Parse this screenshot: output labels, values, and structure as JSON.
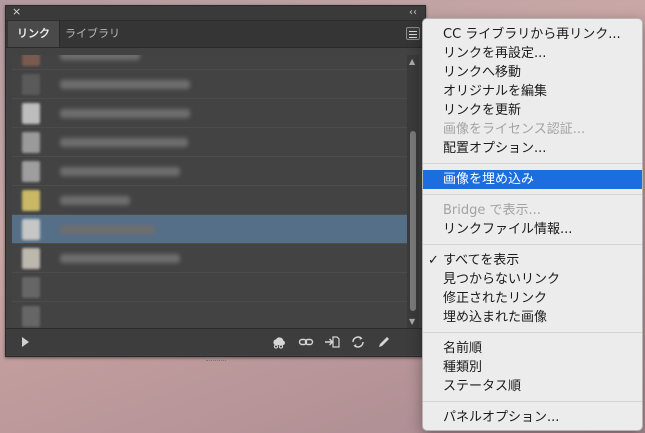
{
  "panel": {
    "tabs": [
      {
        "label": "リンク",
        "active": true
      },
      {
        "label": "ライブラリ",
        "active": false
      }
    ],
    "close_glyph": "×",
    "collapse_glyph": "‹‹",
    "selected_row_index": 6,
    "row_count": 10,
    "bottom_tools": [
      "cc-library-relink-icon",
      "relink-icon",
      "go-to-link-icon",
      "update-link-icon",
      "edit-original-icon"
    ]
  },
  "menu": {
    "groups": [
      [
        {
          "label": "CC ライブラリから再リンク...",
          "enabled": true
        },
        {
          "label": "リンクを再設定...",
          "enabled": true
        },
        {
          "label": "リンクへ移動",
          "enabled": true
        },
        {
          "label": "オリジナルを編集",
          "enabled": true
        },
        {
          "label": "リンクを更新",
          "enabled": true
        },
        {
          "label": "画像をライセンス認証...",
          "enabled": false
        },
        {
          "label": "配置オプション...",
          "enabled": true
        }
      ],
      [
        {
          "label": "画像を埋め込み",
          "enabled": true,
          "highlighted": true
        }
      ],
      [
        {
          "label": "Bridge で表示...",
          "enabled": false
        },
        {
          "label": "リンクファイル情報...",
          "enabled": true
        }
      ],
      [
        {
          "label": "すべてを表示",
          "enabled": true,
          "checked": true
        },
        {
          "label": "見つからないリンク",
          "enabled": true
        },
        {
          "label": "修正されたリンク",
          "enabled": true
        },
        {
          "label": "埋め込まれた画像",
          "enabled": true
        }
      ],
      [
        {
          "label": "名前順",
          "enabled": true
        },
        {
          "label": "種類別",
          "enabled": true
        },
        {
          "label": "ステータス順",
          "enabled": true
        }
      ],
      [
        {
          "label": "パネルオプション...",
          "enabled": true
        }
      ]
    ],
    "check_glyph": "✓",
    "colors": {
      "highlight": "#1b6de0",
      "disabled_text": "#a3a3a3"
    }
  }
}
